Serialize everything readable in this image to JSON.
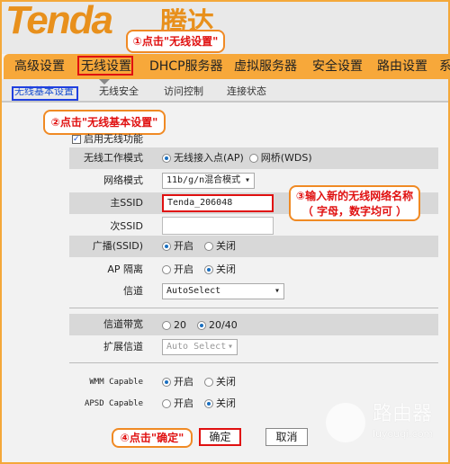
{
  "brand": {
    "logo": "Tenda",
    "logo_cn": "腾达"
  },
  "nav": [
    "高级设置",
    "无线设置",
    "DHCP服务器",
    "虚拟服务器",
    "安全设置",
    "路由设置",
    "系"
  ],
  "subnav": [
    "无线基本设置",
    "无线安全",
    "访问控制",
    "连接状态"
  ],
  "callouts": {
    "c1": "①点击\"无线设置\"",
    "c2": "②点击\"无线基本设置\"",
    "c3_line1": "③输入新的无线网络名称",
    "c3_line2": "（ 字母，数字均可 ）",
    "c4": "④点击\"确定\""
  },
  "form": {
    "enable_label": "启用无线功能",
    "mode_label": "无线工作模式",
    "mode_ap": "无线接入点(AP)",
    "mode_wds": "网桥(WDS)",
    "netmode_label": "网络模式",
    "netmode_value": "11b/g/n混合模式",
    "ssid_label": "主SSID",
    "ssid_value": "Tenda_206048",
    "ssid2_label": "次SSID",
    "ssid2_value": "",
    "broadcast_label": "广播(SSID)",
    "on": "开启",
    "off": "关闭",
    "apiso_label": "AP 隔离",
    "channel_label": "信道",
    "channel_value": "AutoSelect",
    "bw_label": "信道带宽",
    "bw_20": "20",
    "bw_2040": "20/40",
    "ext_label": "扩展信道",
    "ext_value": "Auto Select",
    "wmm_label": "WMM Capable",
    "apsd_label": "APSD Capable"
  },
  "buttons": {
    "ok": "确定",
    "cancel": "取消"
  },
  "watermark": {
    "cn": "路由器",
    "url": "luyouqi.com"
  }
}
